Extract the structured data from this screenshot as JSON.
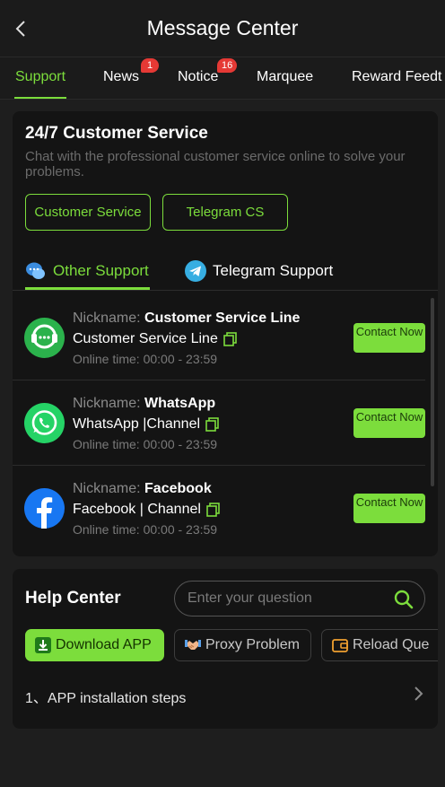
{
  "header": {
    "title": "Message Center"
  },
  "tabs": [
    {
      "label": "Support",
      "badge": ""
    },
    {
      "label": "News",
      "badge": "1"
    },
    {
      "label": "Notice",
      "badge": "16"
    },
    {
      "label": "Marquee",
      "badge": ""
    },
    {
      "label": "Reward Feedt",
      "badge": ""
    }
  ],
  "support": {
    "title": "24/7 Customer Service",
    "description": "Chat with the professional customer service online to solve your problems.",
    "buttons": {
      "customer_service": "Customer Service",
      "telegram_cs": "Telegram CS"
    },
    "subtabs": {
      "other": "Other Support",
      "telegram": "Telegram Support"
    },
    "nickname_label": "Nickname:",
    "contact_label": "Contact Now",
    "contacts": [
      {
        "nickname": "Customer Service Line",
        "channel": "Customer Service Line",
        "online": "Online time: 00:00 - 23:59",
        "icon": "headset-icon",
        "color": "#2bb24c"
      },
      {
        "nickname": "WhatsApp",
        "channel": "WhatsApp |Channel",
        "online": "Online time: 00:00 - 23:59",
        "icon": "whatsapp-icon",
        "color": "#25d366"
      },
      {
        "nickname": "Facebook",
        "channel": "Facebook | Channel",
        "online": "Online time: 00:00 - 23:59",
        "icon": "facebook-icon",
        "color": "#1877f2"
      }
    ]
  },
  "help": {
    "title": "Help Center",
    "search_placeholder": "Enter your question",
    "chips": [
      "Download APP",
      "Proxy Problem",
      "Reload Que"
    ],
    "items": [
      "1、APP installation steps"
    ]
  },
  "colors": {
    "accent": "#7cdd3c",
    "badge": "#e53935",
    "panel": "#141414",
    "background": "#1e1e1e"
  }
}
